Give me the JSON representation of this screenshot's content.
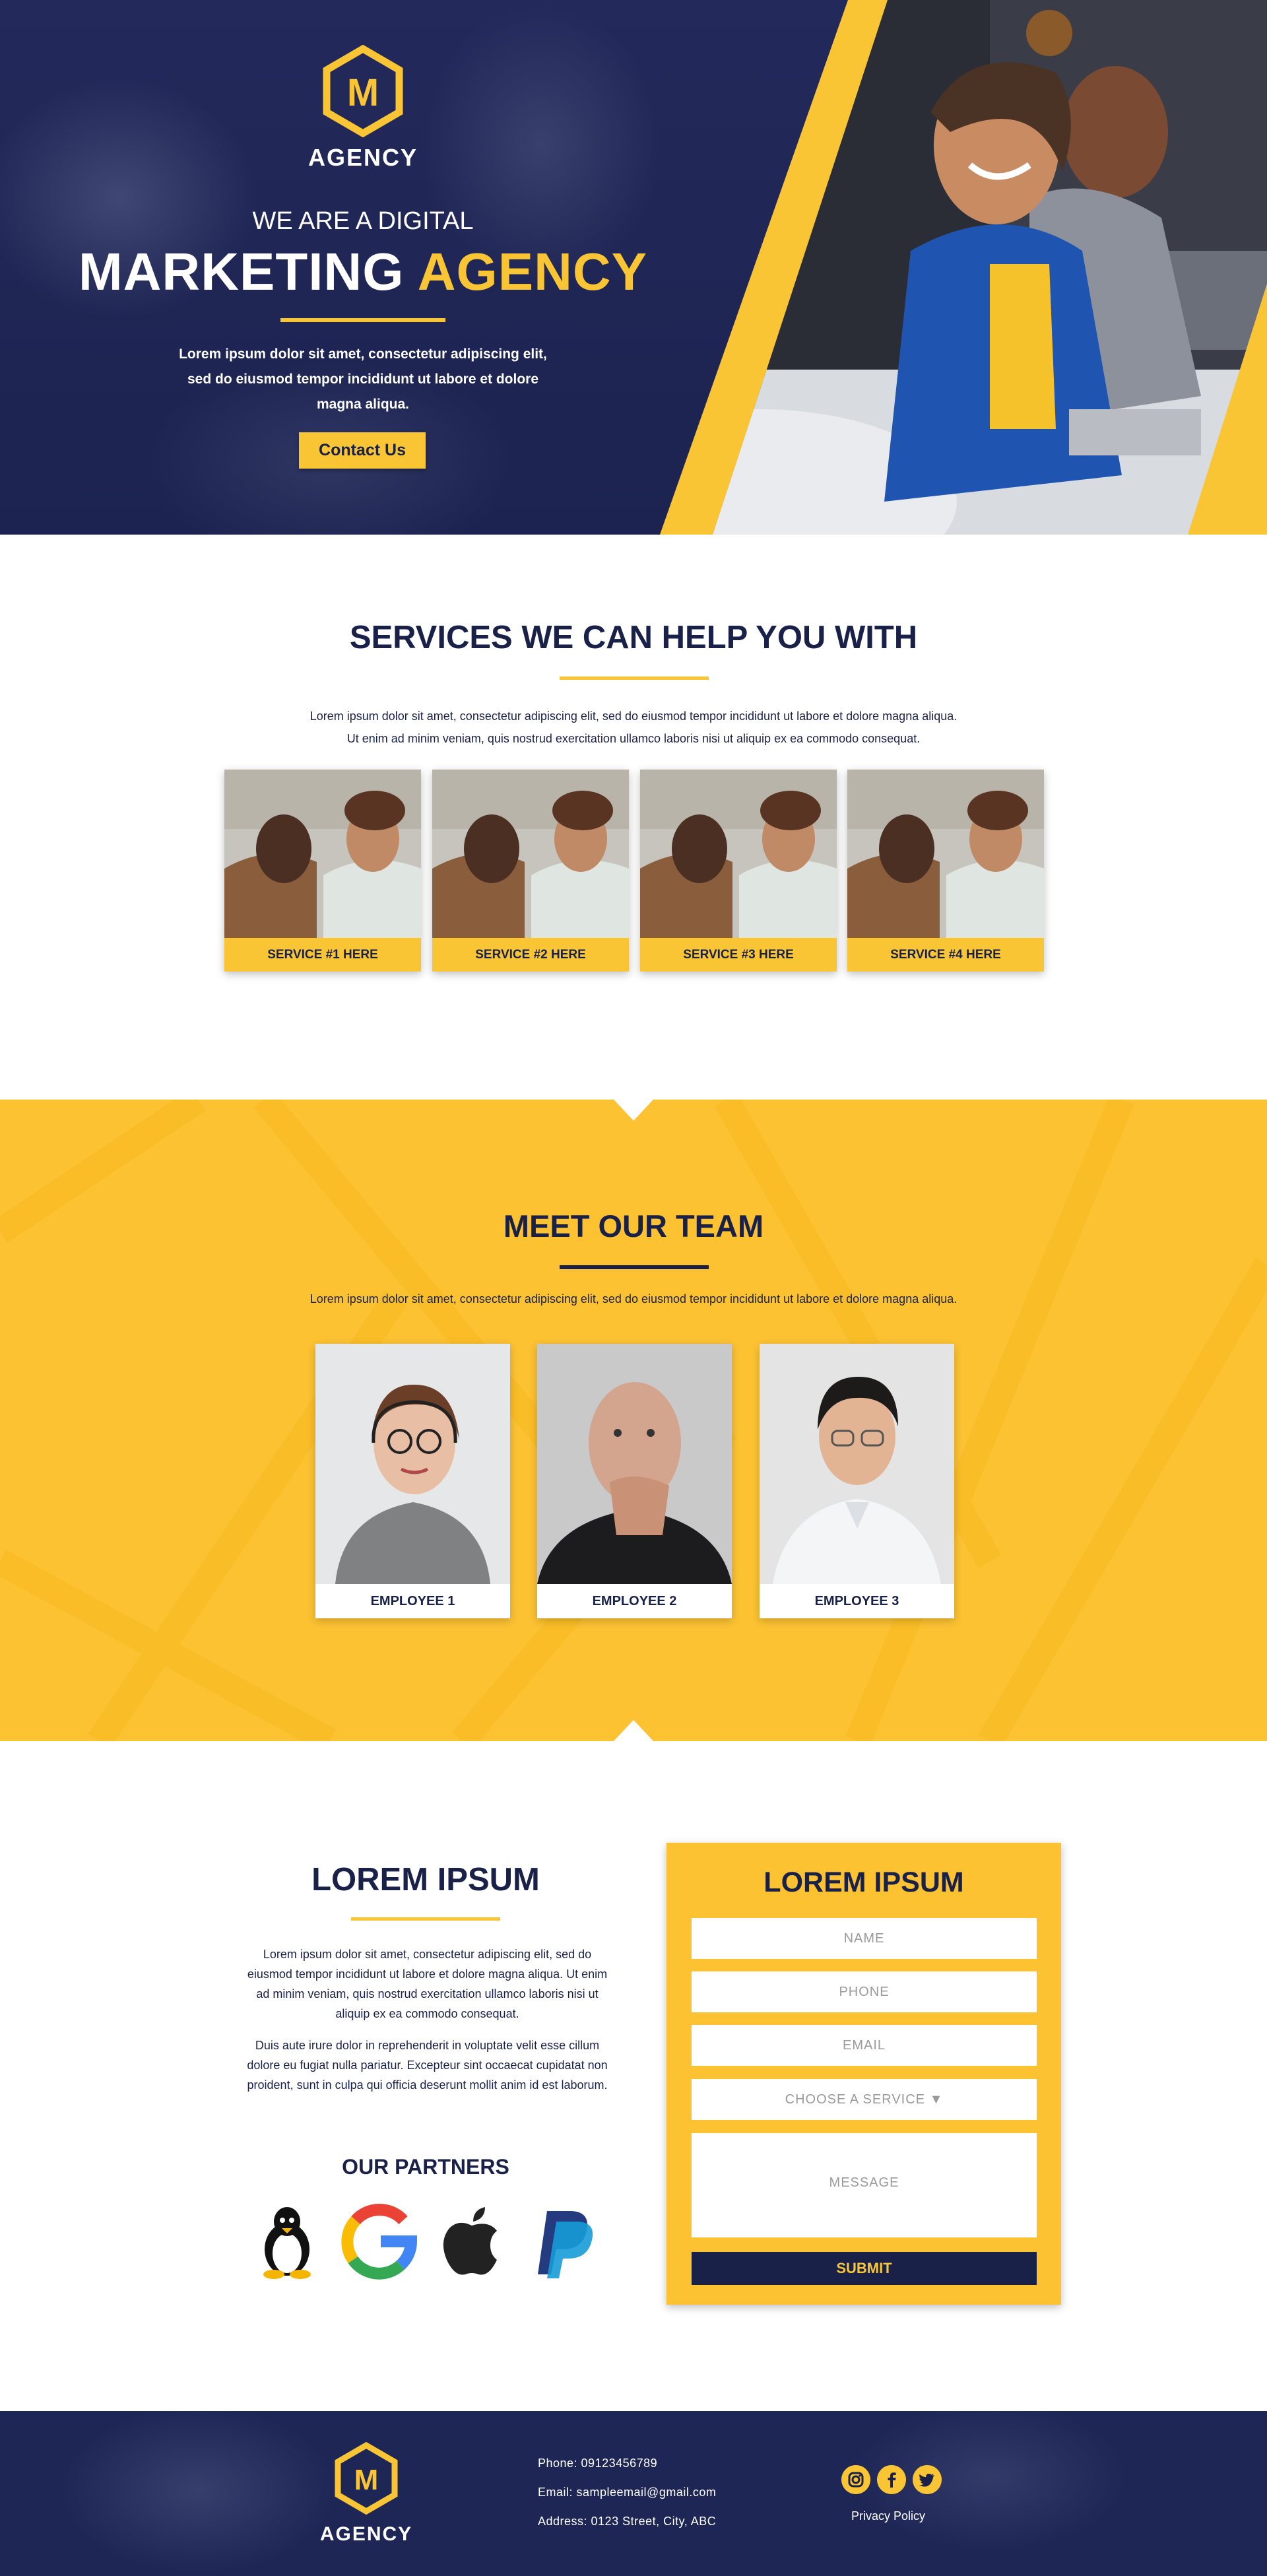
{
  "colors": {
    "navy": "#1a2148",
    "yellow": "#f9c535",
    "white": "#ffffff"
  },
  "hero": {
    "brand": "AGENCY",
    "logo_letter": "M",
    "pretitle": "WE ARE A DIGITAL",
    "title_main": "MARKETING",
    "title_accent": "AGENCY",
    "text": "Lorem ipsum dolor sit amet, consectetur adipiscing elit, sed do eiusmod tempor incididunt ut labore et dolore magna aliqua.",
    "cta": "Contact Us"
  },
  "services": {
    "title": "SERVICES WE CAN HELP YOU WITH",
    "text_line1": "Lorem ipsum dolor sit amet, consectetur adipiscing elit, sed do eiusmod tempor incididunt ut labore et dolore magna aliqua.",
    "text_line2": "Ut enim ad minim veniam, quis nostrud exercitation ullamco laboris nisi ut aliquip ex ea commodo consequat.",
    "items": [
      {
        "label": "SERVICE #1 HERE"
      },
      {
        "label": "SERVICE #2 HERE"
      },
      {
        "label": "SERVICE #3 HERE"
      },
      {
        "label": "SERVICE #4 HERE"
      }
    ]
  },
  "team": {
    "title": "MEET OUR TEAM",
    "text": "Lorem ipsum dolor sit amet, consectetur adipiscing elit, sed do eiusmod tempor incididunt ut labore et dolore magna aliqua.",
    "members": [
      {
        "name": "EMPLOYEE 1"
      },
      {
        "name": "EMPLOYEE 2"
      },
      {
        "name": "EMPLOYEE 3"
      }
    ]
  },
  "about": {
    "title": "LOREM IPSUM",
    "para1": "Lorem ipsum dolor sit amet, consectetur adipiscing elit, sed do eiusmod tempor incididunt ut labore et dolore magna aliqua. Ut enim ad minim veniam, quis nostrud exercitation ullamco laboris nisi ut aliquip ex ea commodo consequat.",
    "para2": "Duis aute irure dolor in reprehenderit in voluptate velit esse cillum dolore eu fugiat nulla pariatur. Excepteur sint occaecat cupidatat non proident, sunt in culpa qui officia deserunt mollit anim id est laborum.",
    "partners_title": "OUR PARTNERS",
    "partners": [
      "linux-icon",
      "google-icon",
      "apple-icon",
      "paypal-icon"
    ]
  },
  "form": {
    "title": "LOREM IPSUM",
    "name_placeholder": "NAME",
    "phone_placeholder": "PHONE",
    "email_placeholder": "EMAIL",
    "service_select": "CHOOSE A SERVICE",
    "service_arrow": "▼",
    "message_placeholder": "MESSAGE",
    "submit": "SUBMIT"
  },
  "footer": {
    "brand": "AGENCY",
    "logo_letter": "M",
    "phone": "Phone: 09123456789",
    "email": "Email: sampleemail@gmail.com",
    "address": "Address: 0123 Street, City, ABC",
    "social": [
      "instagram-icon",
      "facebook-icon",
      "twitter-icon"
    ],
    "privacy": "Privacy Policy"
  }
}
